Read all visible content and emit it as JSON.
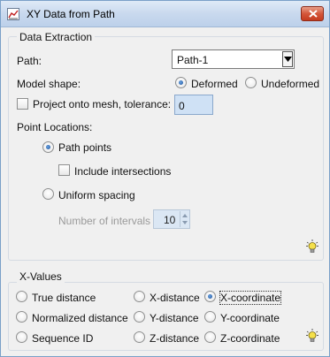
{
  "window": {
    "title": "XY Data from Path"
  },
  "data_extraction": {
    "title": "Data Extraction",
    "path_label": "Path:",
    "path_value": "Path-1",
    "model_shape_label": "Model shape:",
    "model_shape_options": [
      {
        "label": "Deformed",
        "checked": true
      },
      {
        "label": "Undeformed",
        "checked": false
      }
    ],
    "project_label": "Project onto mesh, tolerance:",
    "project_checked": false,
    "tolerance_value": "0",
    "point_locations_label": "Point Locations:",
    "path_points_label": "Path points",
    "path_points_checked": true,
    "include_intersections_label": "Include intersections",
    "include_intersections_checked": false,
    "uniform_spacing_label": "Uniform spacing",
    "uniform_spacing_checked": false,
    "num_intervals_label": "Number of intervals",
    "num_intervals_value": "10"
  },
  "x_values": {
    "title": "X-Values",
    "options": [
      {
        "label": "True distance",
        "checked": false
      },
      {
        "label": "X-distance",
        "checked": false
      },
      {
        "label": "X-coordinate",
        "checked": true
      },
      {
        "label": "Normalized distance",
        "checked": false
      },
      {
        "label": "Y-distance",
        "checked": false
      },
      {
        "label": "Y-coordinate",
        "checked": false
      },
      {
        "label": "Sequence ID",
        "checked": false
      },
      {
        "label": "Z-distance",
        "checked": false
      },
      {
        "label": "Z-coordinate",
        "checked": false
      }
    ]
  },
  "icons": {
    "app": "xy-plot-icon",
    "close": "close-icon",
    "hint": "lightbulb-icon"
  },
  "colors": {
    "titlebar": "#c9d9ee",
    "close_button": "#d4563a",
    "input_highlight": "#cfe1f5",
    "radio_dot": "#1a4f9a",
    "bulb": "#f5e04a"
  }
}
